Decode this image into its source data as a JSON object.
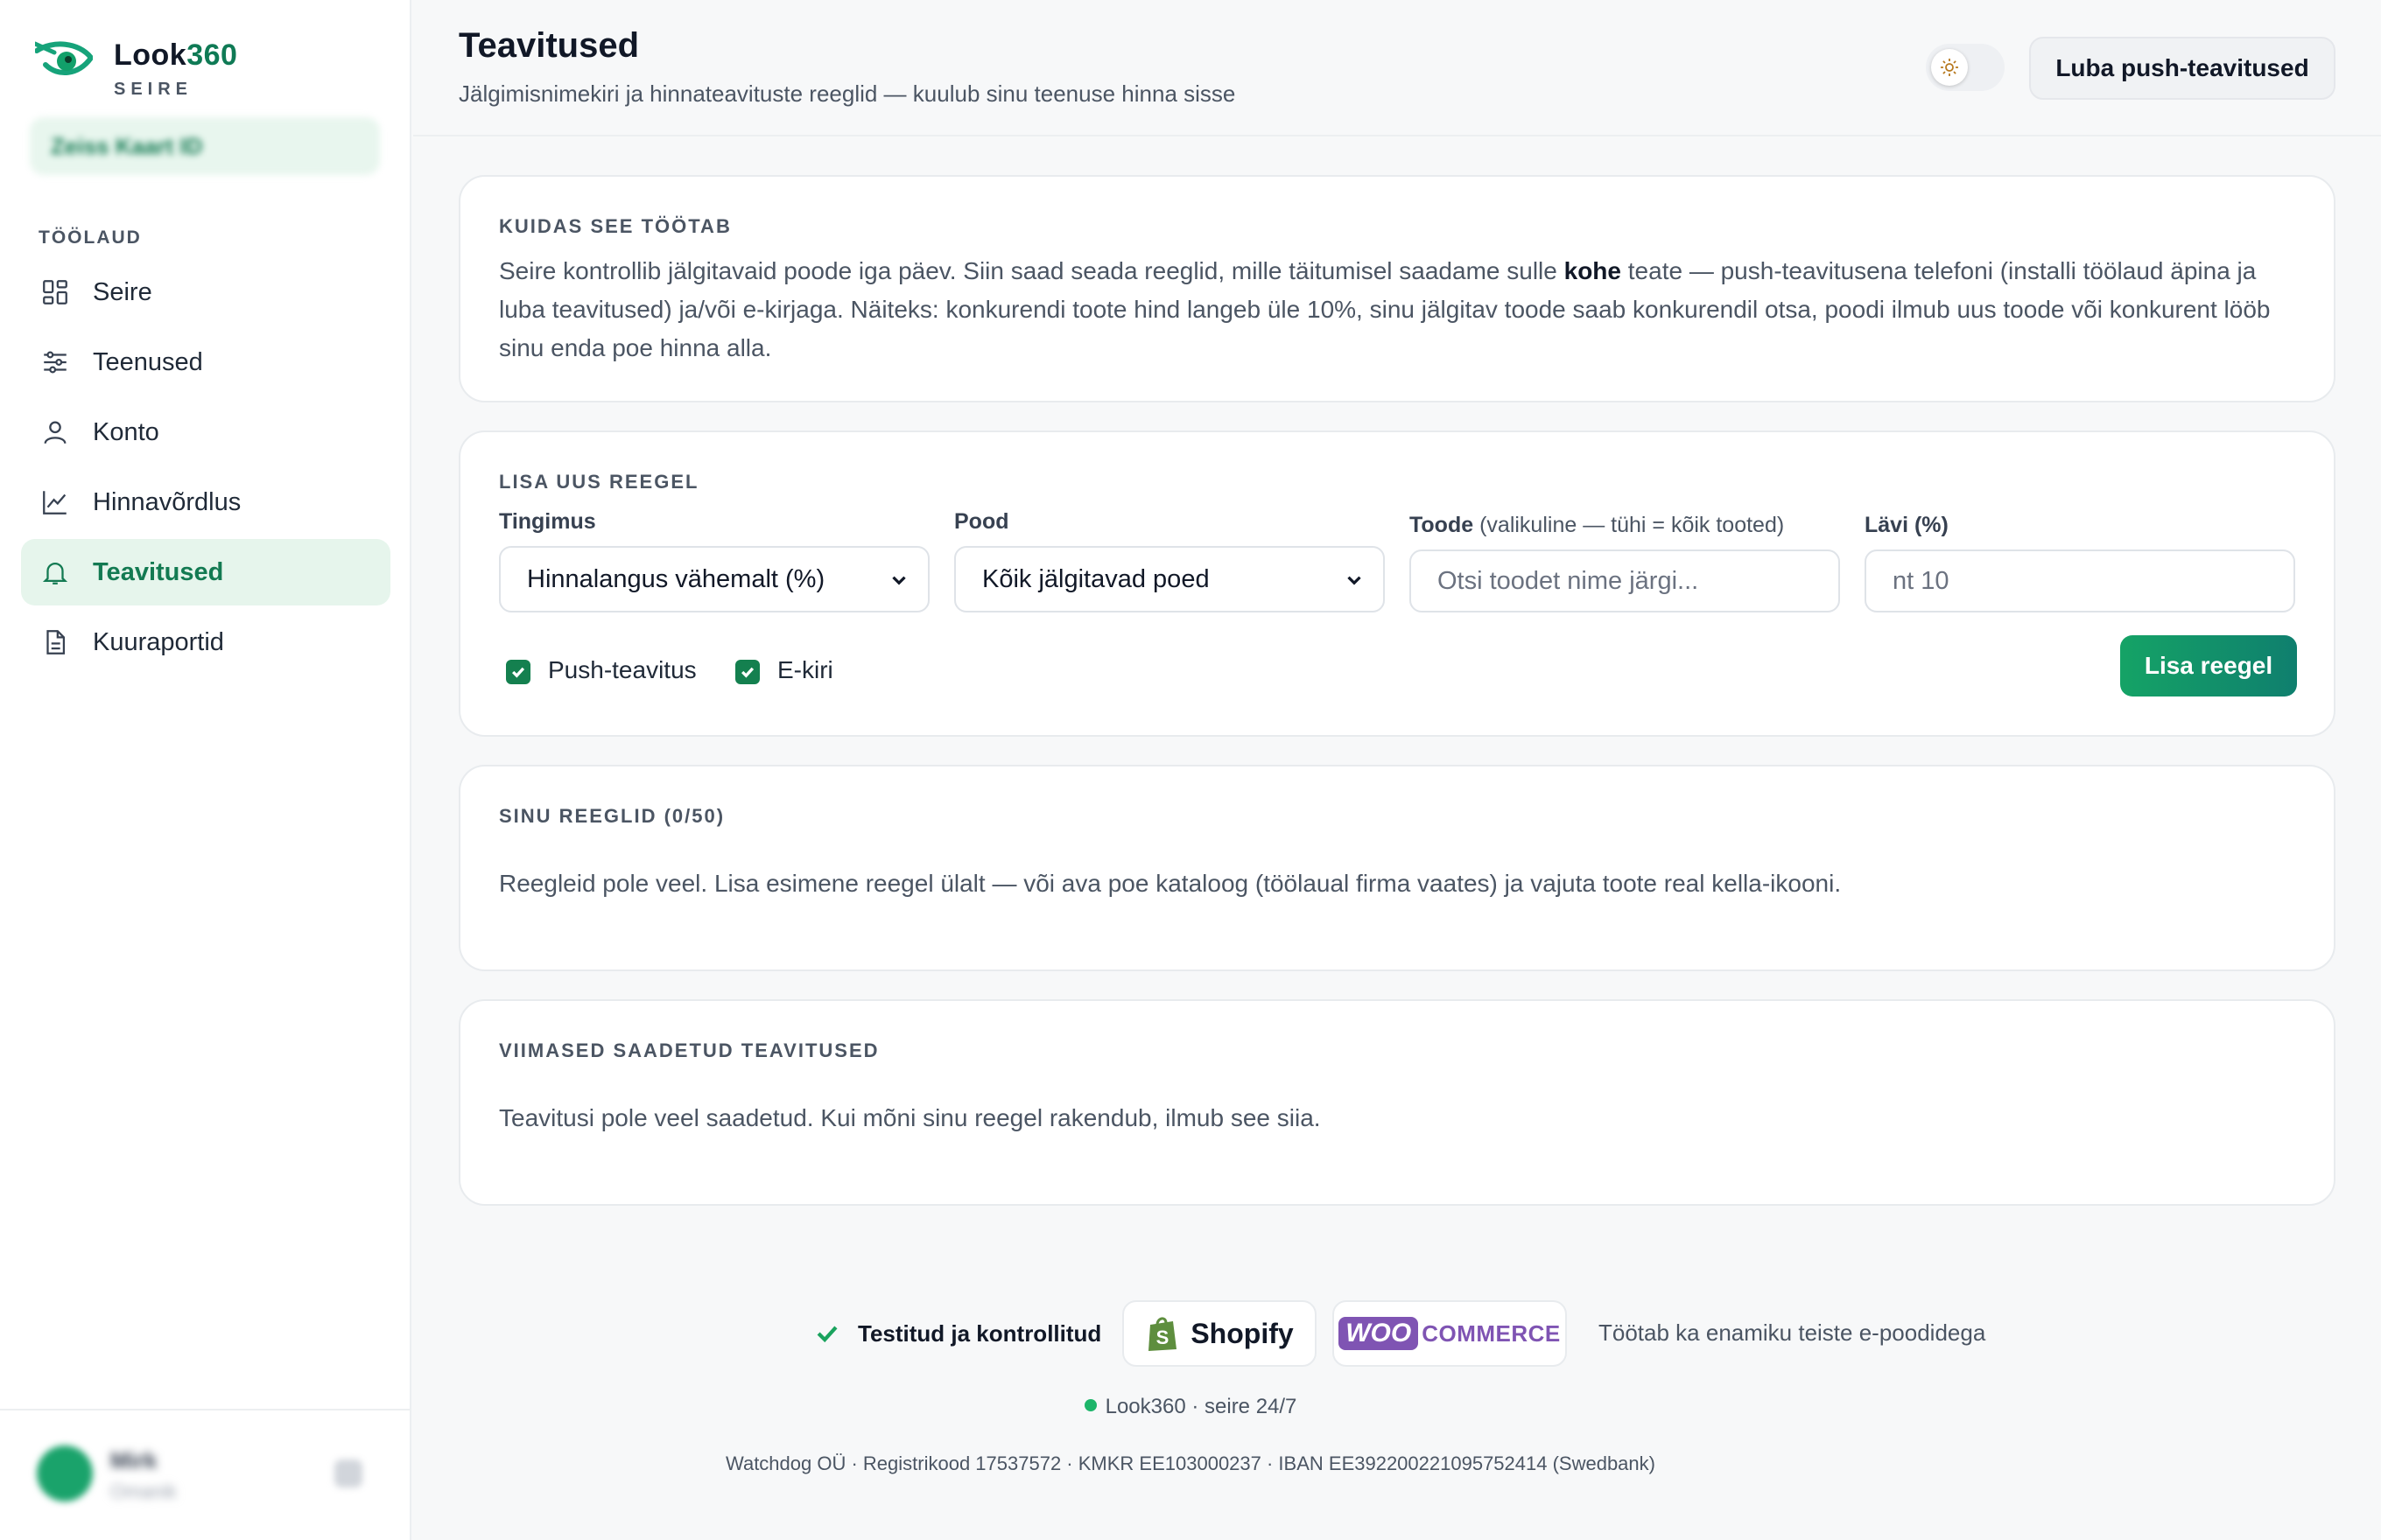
{
  "brand": {
    "name_prefix": "Look",
    "name_suffix": "360",
    "subtitle": "SEIRE",
    "company": "Zeiss Kaart ID"
  },
  "sidebar": {
    "heading": "TÖÖLAUD",
    "items": [
      {
        "label": "Seire",
        "icon": "grid-icon",
        "active": false
      },
      {
        "label": "Teenused",
        "icon": "sliders-icon",
        "active": false
      },
      {
        "label": "Konto",
        "icon": "user-icon",
        "active": false
      },
      {
        "label": "Hinnavõrdlus",
        "icon": "chart-icon",
        "active": false
      },
      {
        "label": "Teavitused",
        "icon": "bell-icon",
        "active": true
      },
      {
        "label": "Kuuraportid",
        "icon": "file-icon",
        "active": false
      }
    ],
    "user": {
      "name": "Mirk",
      "role": "Omanik"
    }
  },
  "header": {
    "title": "Teavitused",
    "subtitle": "Jälgimisnimekiri ja hinnateavituste reeglid — kuulub sinu teenuse hinna sisse",
    "push_button": "Luba push-teavitused"
  },
  "how_it_works": {
    "title": "KUIDAS SEE TÖÖTAB",
    "text_before": "Seire kontrollib jälgitavaid poode iga päev. Siin saad seada reeglid, mille täitumisel saadame sulle ",
    "text_bold": "kohe",
    "text_after": " teate — push-teavitusena telefoni (installi töölaud äpina ja luba teavitused) ja/või e-kirjaga. Näiteks: konkurendi toote hind langeb üle 10%, sinu jälgitav toode saab konkurendil otsa, poodi ilmub uus toode või konkurent lööb sinu enda poe hinna alla."
  },
  "new_rule": {
    "title": "LISA UUS REEGEL",
    "condition_label": "Tingimus",
    "condition_value": "Hinnalangus vähemalt (%)",
    "shop_label": "Pood",
    "shop_value": "Kõik jälgitavad poed",
    "product_label": "Toode",
    "product_hint": "(valikuline — tühi = kõik tooted)",
    "product_placeholder": "Otsi toodet nime järgi...",
    "threshold_label": "Lävi (%)",
    "threshold_placeholder": "nt 10",
    "push_label": "Push-teavitus",
    "push_checked": true,
    "email_label": "E-kiri",
    "email_checked": true,
    "add_button": "Lisa reegel"
  },
  "my_rules": {
    "title": "SINU REEGLID (0/50)",
    "empty": "Reegleid pole veel. Lisa esimene reegel ülalt — või ava poe kataloog (töölaual firma vaates) ja vajuta toote real kella-ikooni."
  },
  "recent": {
    "title": "VIIMASED SAADETUD TEAVITUSED",
    "empty": "Teavitusi pole veel saadetud. Kui mõni sinu reegel rakendub, ilmub see siia."
  },
  "footer": {
    "tested": "Testitud ja kontrollitud",
    "shopify": "Shopify",
    "woo_prefix": "WOO",
    "woo_suffix": "COMMERCE",
    "works_with": "Töötab ka enamiku teiste e-poodidega",
    "status": "Look360 · seire 24/7",
    "company": "Watchdog OÜ · Registrikood 17537572 · KMKR EE103000237 · IBAN EE392200221095752414 (Swedbank)"
  },
  "colors": {
    "accent": "#137a52",
    "active_bg": "#e6f5ec",
    "button_start": "#15a366",
    "button_end": "#0f7f6e"
  }
}
